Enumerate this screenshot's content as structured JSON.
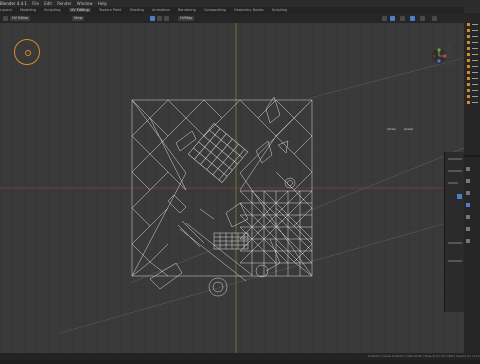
{
  "app": {
    "title": "Blender 4.4.1",
    "menu": [
      "File",
      "Edit",
      "Render",
      "Window",
      "Help"
    ]
  },
  "tabs": [
    "Layout",
    "Modeling",
    "Sculpting",
    "UV Editing",
    "Texture Paint",
    "Shading",
    "Animation",
    "Rendering",
    "Compositing",
    "Geometry Nodes",
    "Scripting"
  ],
  "active_tab": "UV Editing",
  "header": {
    "mode_label": "UV Editor",
    "view_label": "View",
    "mode_select": "Texture",
    "sync_select": "UVMap"
  },
  "viewport": {
    "tag_left": "Vertex",
    "tag_right": "Global"
  },
  "status": {
    "text": "Collection | Scene Collection | Verts 0/150 | Faces 0/70 | Tris 3,804 | Objects 1/1 | 4.4.1"
  },
  "colors": {
    "accent": "#d68a2a",
    "grid_x_axis": "#8a3a3a",
    "grid_y_axis": "#6d8a2a",
    "uv_wire": "#dcdcdc"
  },
  "icons": [
    "cursor-icon",
    "view-gizmo-icon",
    "zoom-icon",
    "hand-icon",
    "camera-icon",
    "outliner-expand-icon"
  ]
}
